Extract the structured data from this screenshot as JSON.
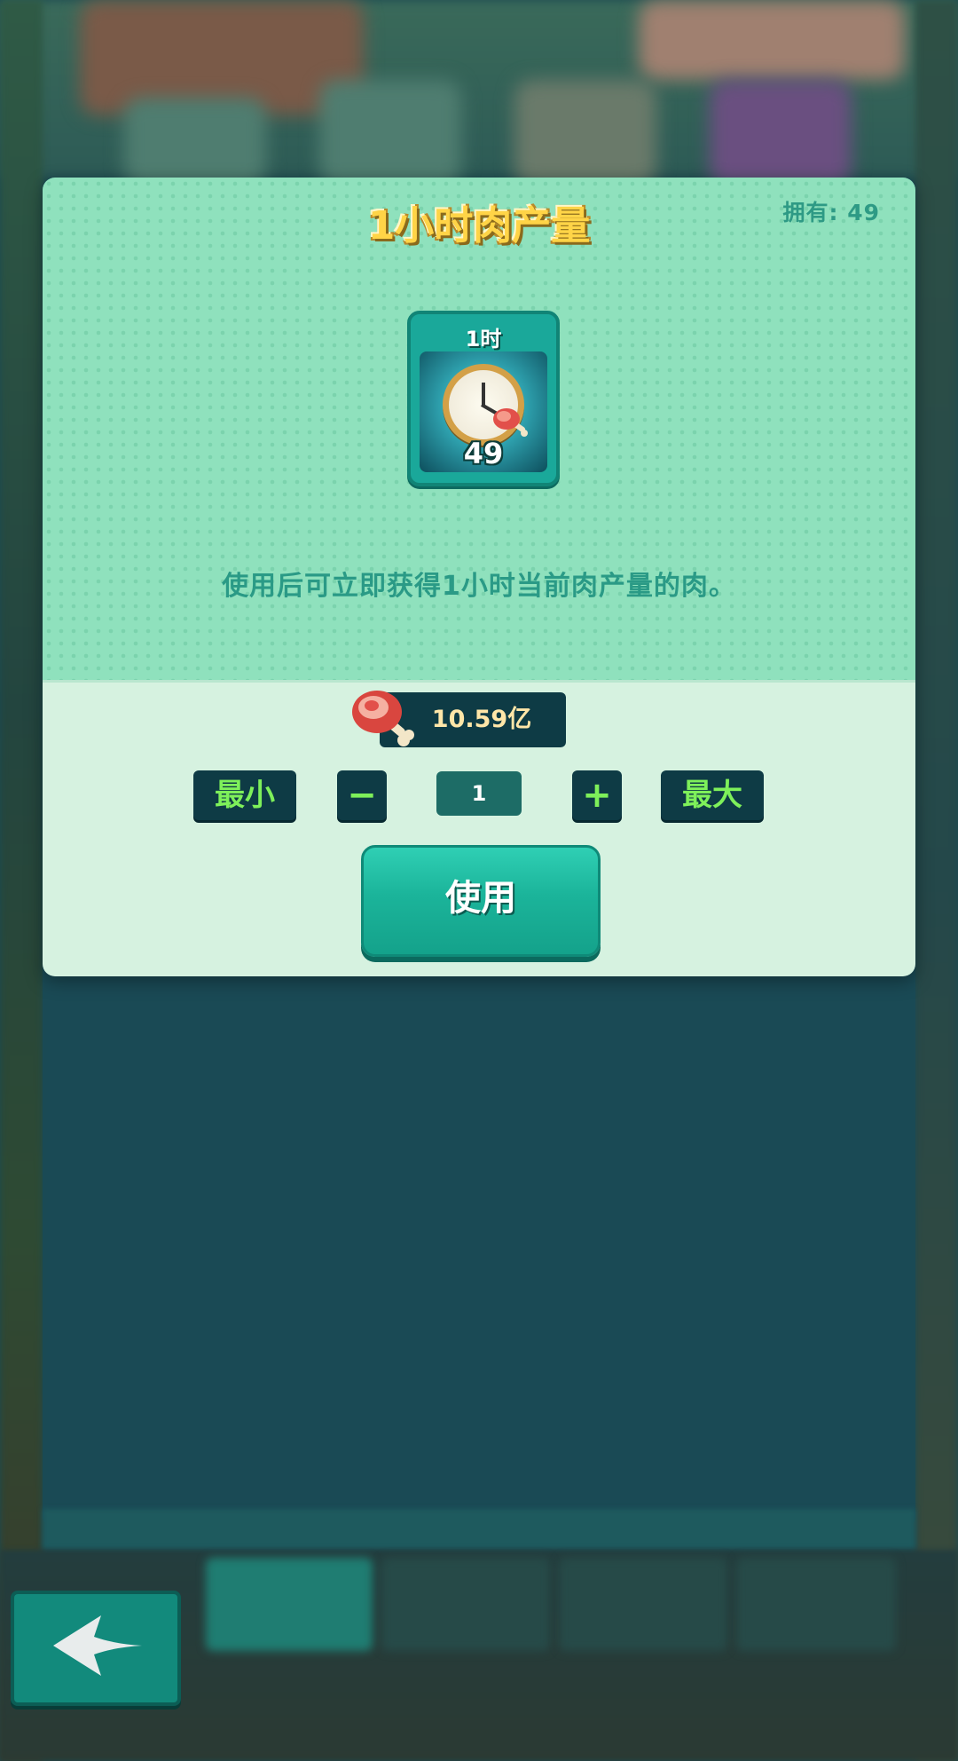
{
  "dialog": {
    "title": "1小时肉产量",
    "owned_label": "拥有: 49",
    "item": {
      "label": "1时",
      "count": "49",
      "icon": "clock-meat-icon"
    },
    "description": "使用后可立即获得1小时当前肉产量的肉。",
    "reward": {
      "icon": "meat-icon",
      "value": "10.59亿"
    },
    "quantity": {
      "min_label": "最小",
      "minus_label": "−",
      "value": "1",
      "plus_label": "+",
      "max_label": "最大"
    },
    "use_button_label": "使用"
  },
  "nav": {
    "back_icon": "back-arrow-icon"
  },
  "colors": {
    "panel_top": "#8fe1bd",
    "panel_bottom": "#d6f2e0",
    "title": "#ffd447",
    "accent_green": "#7ef05a",
    "dark_button": "#0e3b45",
    "use_button": "#1bb49a"
  }
}
